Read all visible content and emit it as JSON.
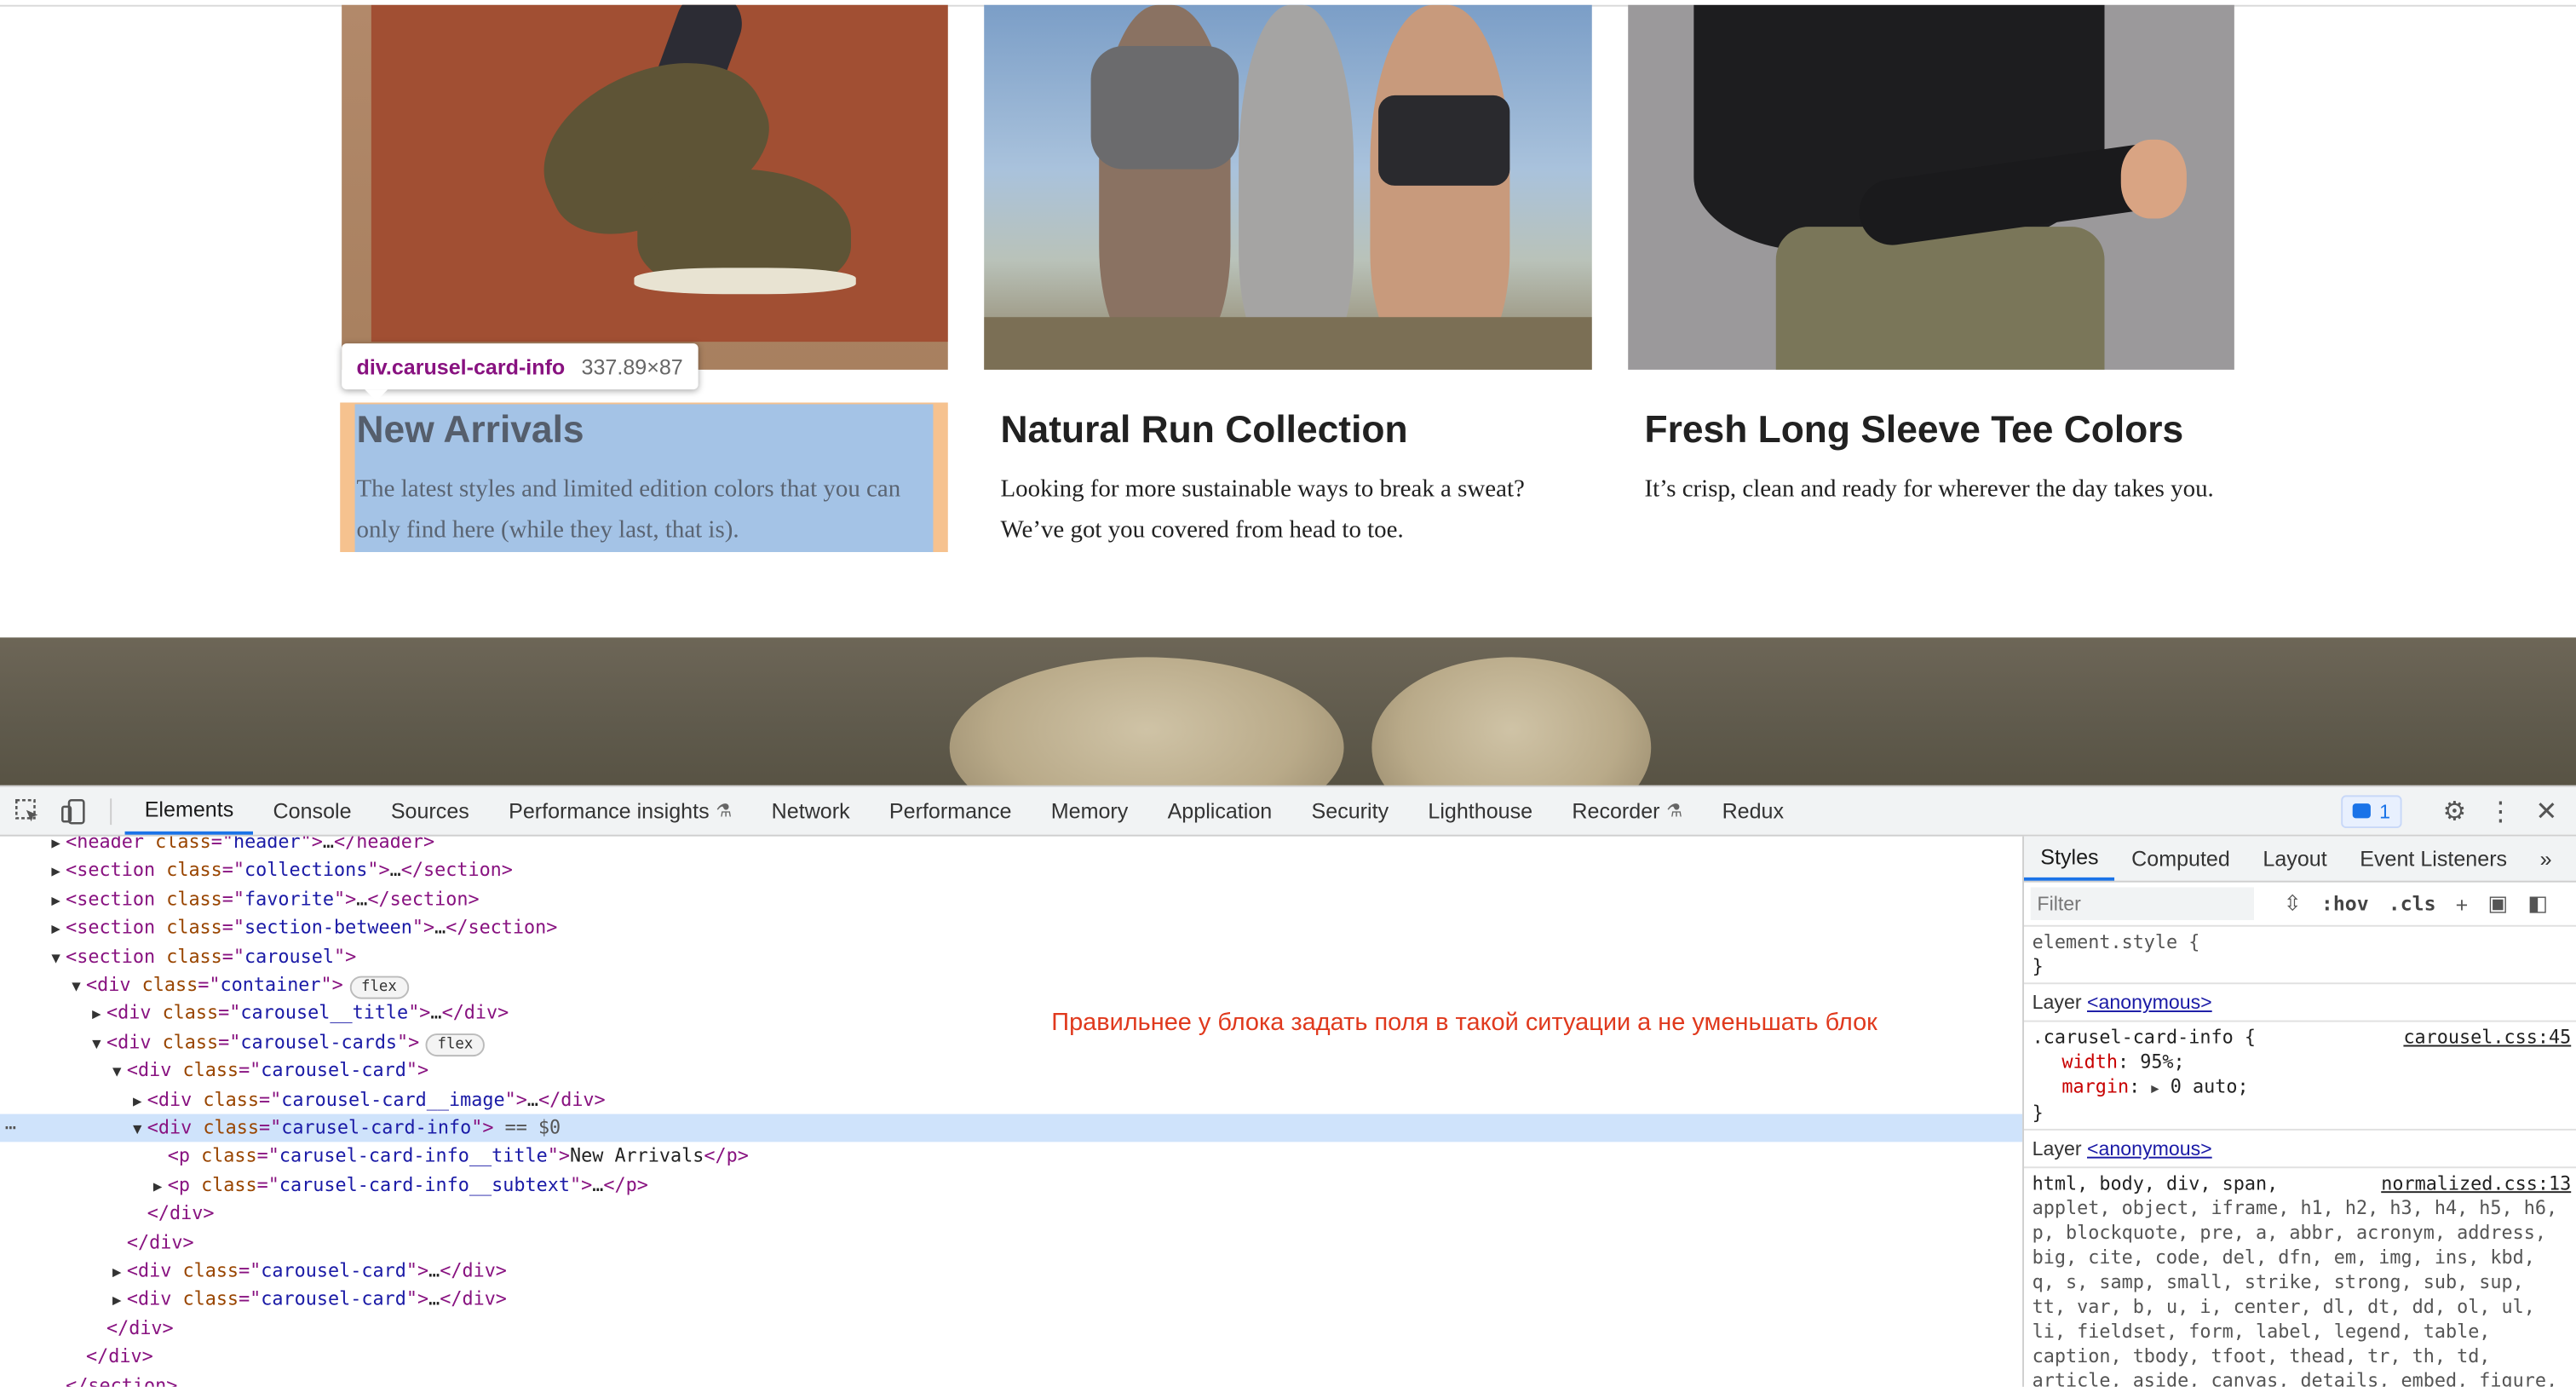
{
  "page": {
    "tooltip": {
      "selector": "div.carusel-card-info",
      "dimensions": "337.89×87"
    },
    "cards": [
      {
        "title": "New Arrivals",
        "subtext": "The latest styles and limited edition colors that you can only find here (while they last, that is)."
      },
      {
        "title": "Natural Run Collection",
        "subtext": "Looking for more sustainable ways to break a sweat? We’ve got you covered from head to toe."
      },
      {
        "title": "Fresh Long Sleeve Tee Colors",
        "subtext": "It’s crisp, clean and ready for wherever the day takes you."
      }
    ]
  },
  "devtools": {
    "tabs": [
      "Elements",
      "Console",
      "Sources",
      "Performance insights",
      "Network",
      "Performance",
      "Memory",
      "Application",
      "Security",
      "Lighthouse",
      "Recorder",
      "Redux"
    ],
    "active_tab": "Elements",
    "issues_count": "1",
    "dom_lines": [
      {
        "indent": 0,
        "tri": "▶",
        "html": [
          [
            "tag",
            "<header "
          ],
          [
            "attr",
            "class"
          ],
          [
            "tag",
            "=\""
          ],
          [
            "val",
            "header"
          ],
          [
            "tag",
            "\">"
          ],
          [
            "txt",
            "…"
          ],
          [
            "tag",
            "</header>"
          ]
        ]
      },
      {
        "indent": 0,
        "tri": "▶",
        "html": [
          [
            "tag",
            "<section "
          ],
          [
            "attr",
            "class"
          ],
          [
            "tag",
            "=\""
          ],
          [
            "val",
            "collections"
          ],
          [
            "tag",
            "\">"
          ],
          [
            "txt",
            "…"
          ],
          [
            "tag",
            "</section>"
          ]
        ]
      },
      {
        "indent": 0,
        "tri": "▶",
        "html": [
          [
            "tag",
            "<section "
          ],
          [
            "attr",
            "class"
          ],
          [
            "tag",
            "=\""
          ],
          [
            "val",
            "favorite"
          ],
          [
            "tag",
            "\">"
          ],
          [
            "txt",
            "…"
          ],
          [
            "tag",
            "</section>"
          ]
        ]
      },
      {
        "indent": 0,
        "tri": "▶",
        "html": [
          [
            "tag",
            "<section "
          ],
          [
            "attr",
            "class"
          ],
          [
            "tag",
            "=\""
          ],
          [
            "val",
            "section-between"
          ],
          [
            "tag",
            "\">"
          ],
          [
            "txt",
            "…"
          ],
          [
            "tag",
            "</section>"
          ]
        ]
      },
      {
        "indent": 0,
        "tri": "▼",
        "html": [
          [
            "tag",
            "<section "
          ],
          [
            "attr",
            "class"
          ],
          [
            "tag",
            "=\""
          ],
          [
            "val",
            "carousel"
          ],
          [
            "tag",
            "\">"
          ]
        ]
      },
      {
        "indent": 1,
        "tri": "▼",
        "html": [
          [
            "tag",
            "<div "
          ],
          [
            "attr",
            "class"
          ],
          [
            "tag",
            "=\""
          ],
          [
            "val",
            "container"
          ],
          [
            "tag",
            "\">"
          ]
        ],
        "pill": "flex"
      },
      {
        "indent": 2,
        "tri": "▶",
        "html": [
          [
            "tag",
            "<div "
          ],
          [
            "attr",
            "class"
          ],
          [
            "tag",
            "=\""
          ],
          [
            "val",
            "carousel__title"
          ],
          [
            "tag",
            "\">"
          ],
          [
            "txt",
            "…"
          ],
          [
            "tag",
            "</div>"
          ]
        ]
      },
      {
        "indent": 2,
        "tri": "▼",
        "html": [
          [
            "tag",
            "<div "
          ],
          [
            "attr",
            "class"
          ],
          [
            "tag",
            "=\""
          ],
          [
            "val",
            "carousel-cards"
          ],
          [
            "tag",
            "\">"
          ]
        ],
        "pill": "flex"
      },
      {
        "indent": 3,
        "tri": "▼",
        "html": [
          [
            "tag",
            "<div "
          ],
          [
            "attr",
            "class"
          ],
          [
            "tag",
            "=\""
          ],
          [
            "val",
            "carousel-card"
          ],
          [
            "tag",
            "\">"
          ]
        ]
      },
      {
        "indent": 4,
        "tri": "▶",
        "html": [
          [
            "tag",
            "<div "
          ],
          [
            "attr",
            "class"
          ],
          [
            "tag",
            "=\""
          ],
          [
            "val",
            "carousel-card__image"
          ],
          [
            "tag",
            "\">"
          ],
          [
            "txt",
            "…"
          ],
          [
            "tag",
            "</div>"
          ]
        ]
      },
      {
        "indent": 4,
        "tri": "▼",
        "html": [
          [
            "tag",
            "<div "
          ],
          [
            "attr",
            "class"
          ],
          [
            "tag",
            "=\""
          ],
          [
            "val",
            "carusel-card-info"
          ],
          [
            "tag",
            "\">"
          ],
          [
            "dim",
            " == $0"
          ]
        ],
        "selected": true
      },
      {
        "indent": 5,
        "tri": "",
        "html": [
          [
            "tag",
            "<p "
          ],
          [
            "attr",
            "class"
          ],
          [
            "tag",
            "=\""
          ],
          [
            "val",
            "carusel-card-info__title"
          ],
          [
            "tag",
            "\">"
          ],
          [
            "txt",
            "New Arrivals"
          ],
          [
            "tag",
            "</p>"
          ]
        ]
      },
      {
        "indent": 5,
        "tri": "▶",
        "html": [
          [
            "tag",
            "<p "
          ],
          [
            "attr",
            "class"
          ],
          [
            "tag",
            "=\""
          ],
          [
            "val",
            "carusel-card-info__subtext"
          ],
          [
            "tag",
            "\">"
          ],
          [
            "txt",
            "…"
          ],
          [
            "tag",
            "</p>"
          ]
        ]
      },
      {
        "indent": 4,
        "tri": "",
        "html": [
          [
            "tag",
            "</div>"
          ]
        ]
      },
      {
        "indent": 3,
        "tri": "",
        "html": [
          [
            "tag",
            "</div>"
          ]
        ]
      },
      {
        "indent": 3,
        "tri": "▶",
        "html": [
          [
            "tag",
            "<div "
          ],
          [
            "attr",
            "class"
          ],
          [
            "tag",
            "=\""
          ],
          [
            "val",
            "carousel-card"
          ],
          [
            "tag",
            "\">"
          ],
          [
            "txt",
            "…"
          ],
          [
            "tag",
            "</div>"
          ]
        ]
      },
      {
        "indent": 3,
        "tri": "▶",
        "html": [
          [
            "tag",
            "<div "
          ],
          [
            "attr",
            "class"
          ],
          [
            "tag",
            "=\""
          ],
          [
            "val",
            "carousel-card"
          ],
          [
            "tag",
            "\">"
          ],
          [
            "txt",
            "…"
          ],
          [
            "tag",
            "</div>"
          ]
        ]
      },
      {
        "indent": 2,
        "tri": "",
        "html": [
          [
            "tag",
            "</div>"
          ]
        ]
      },
      {
        "indent": 1,
        "tri": "",
        "html": [
          [
            "tag",
            "</div>"
          ]
        ]
      },
      {
        "indent": 0,
        "tri": "",
        "html": [
          [
            "tag",
            "</section>"
          ]
        ]
      }
    ],
    "annotation": "Правильнее у блока задать поля в такой ситуации а не уменьшать блок",
    "styles_panel": {
      "tabs": [
        "Styles",
        "Computed",
        "Layout",
        "Event Listeners"
      ],
      "active_tab": "Styles",
      "filter_placeholder": "Filter",
      "hov": ":hov",
      "cls": ".cls",
      "element_style_selector": "element.style {",
      "close_brace": "}",
      "layer_label": "Layer",
      "layer_link": "<anonymous>",
      "rule1": {
        "selector": ".carusel-card-info {",
        "source": "carousel.css:45",
        "props": [
          [
            "width",
            "95%;"
          ],
          [
            "margin",
            "0 auto;"
          ]
        ]
      },
      "rule2": {
        "selector": "html, body, div, span,",
        "source": "normalized.css:13",
        "text": "applet, object, iframe, h1, h2, h3, h4, h5, h6, p, blockquote, pre, a, abbr, acronym, address, big, cite, code, del, dfn, em, img, ins, kbd, q, s, samp, small, strike, strong, sub, sup, tt, var, b, u, i, center, dl, dt, dd, ol, ul, li, fieldset, form, label, legend, table, caption, tbody, tfoot, thead, tr, th, td, article, aside, canvas, details, embed, figure, figcaption, footer, header, hgroup,"
      }
    }
  }
}
